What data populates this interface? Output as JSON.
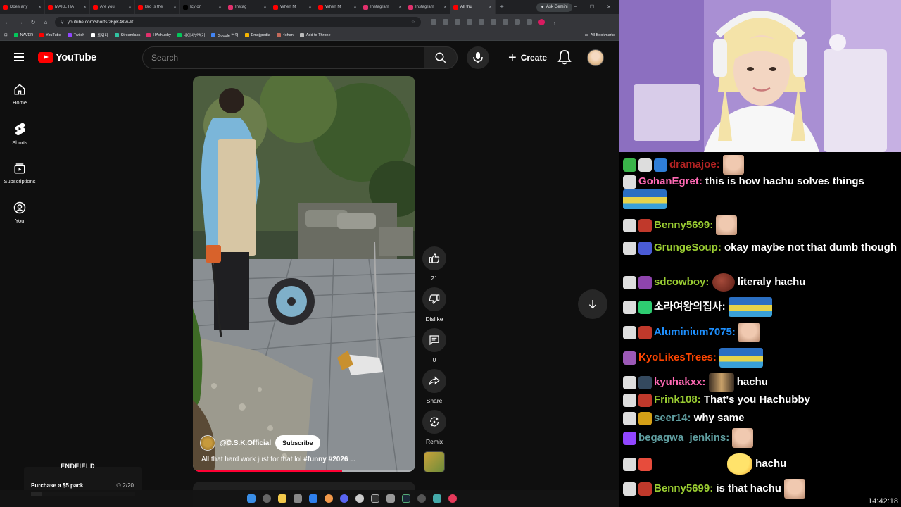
{
  "browser": {
    "tabs": [
      {
        "label": "Does any",
        "color": "#ff0000",
        "active": false
      },
      {
        "label": "MAKE HA",
        "color": "#ff0000",
        "active": false
      },
      {
        "label": "Are you",
        "color": "#ff0000",
        "active": false
      },
      {
        "label": "Bro is the",
        "color": "#ff0000",
        "active": false
      },
      {
        "label": "Icy on",
        "color": "#000000",
        "active": false
      },
      {
        "label": "Instag",
        "color": "#e1306c",
        "active": false
      },
      {
        "label": "When M",
        "color": "#ff0000",
        "active": false
      },
      {
        "label": "When M",
        "color": "#ff0000",
        "active": false
      },
      {
        "label": "Instagram",
        "color": "#e1306c",
        "active": false
      },
      {
        "label": "Instagram",
        "color": "#e1306c",
        "active": false
      },
      {
        "label": "All thu",
        "color": "#ff0000",
        "active": true
      }
    ],
    "new_tab": "+",
    "gemini_label": "Ask Gemini",
    "window_controls": [
      "–",
      "☐",
      "✕"
    ],
    "url": "youtube.com/shorts/26pK4Kw-Ii0",
    "bookmarks": [
      {
        "label": "NAVER",
        "color": "#03c75a"
      },
      {
        "label": "YouTube",
        "color": "#ff0000"
      },
      {
        "label": "Twitch",
        "color": "#9146ff"
      },
      {
        "label": "트위터",
        "color": "#ffffff"
      },
      {
        "label": "Streamlabs",
        "color": "#31c3a2"
      },
      {
        "label": "HAchubby",
        "color": "#e1306c"
      },
      {
        "label": "네이버번역기",
        "color": "#03c75a"
      },
      {
        "label": "Google 번역",
        "color": "#4285f4"
      },
      {
        "label": "Emojipedia",
        "color": "#f7b500"
      },
      {
        "label": "4chan",
        "color": "#c46a5b"
      },
      {
        "label": "Add to Throne",
        "color": "#bbbbbb"
      }
    ],
    "all_bookmarks": "All Bookmarks"
  },
  "youtube": {
    "logo_text": "YouTube",
    "search_placeholder": "Search",
    "create_label": "Create",
    "sidebar": [
      {
        "label": "Home",
        "icon": "home-icon"
      },
      {
        "label": "Shorts",
        "icon": "shorts-icon"
      },
      {
        "label": "Subscriptions",
        "icon": "subscriptions-icon"
      },
      {
        "label": "You",
        "icon": "you-icon"
      }
    ],
    "short": {
      "channel": "@C.S.K.Official",
      "subscribe_label": "Subscribe",
      "caption_text": "All that hard work just for that lol ",
      "caption_tags": "#funny #2026 ...",
      "progress": 0.67
    },
    "actions": {
      "like_count": "21",
      "dislike_label": "Dislike",
      "comment_count": "0",
      "share_label": "Share",
      "remix_label": "Remix"
    }
  },
  "ad": {
    "logo": "ENDFIELD",
    "title": "Purchase a $5 pack",
    "count": "2/20",
    "progress": 0.1
  },
  "chat": {
    "messages": [
      {
        "user": "dramajoe:",
        "color": "#b22222",
        "text": "",
        "badges": [
          "#3ab54a",
          "#dddddd",
          "#2f7ed8"
        ],
        "emote": "face"
      },
      {
        "user": "GohanEgret:",
        "color": "#ff69b4",
        "text": "this is how hachu solves things",
        "badges": [
          "#dddddd"
        ],
        "emote": "car"
      },
      {
        "user": "Benny5699:",
        "color": "#9acd32",
        "text": "",
        "badges": [
          "#dddddd",
          "#c0392b"
        ],
        "emote": "face"
      },
      {
        "user": "GrungeSoup:",
        "color": "#9acd32",
        "text": "okay maybe not that dumb though",
        "badges": [
          "#dddddd",
          "#4a5bd6"
        ],
        "emote": ""
      },
      {
        "user": "sdcowboy:",
        "color": "#9acd32",
        "text": "literaly hachu",
        "badges": [
          "#dddddd",
          "#8e44ad"
        ],
        "emote": "bean"
      },
      {
        "user": "소라여왕의집사:",
        "color": "#ffffff",
        "text": "",
        "badges": [
          "#dddddd",
          "#2ecc71"
        ],
        "emote": "car"
      },
      {
        "user": "Aluminium7075:",
        "color": "#1e90ff",
        "text": "",
        "badges": [
          "#dddddd",
          "#c0392b"
        ],
        "emote": "face"
      },
      {
        "user": "KyoLikesTrees:",
        "color": "#ff4500",
        "text": "",
        "badges": [
          "#9b59b6"
        ],
        "emote": "car"
      },
      {
        "user": "kyuhakxx:",
        "color": "#ff69b4",
        "text": "hachu",
        "badges": [
          "#dddddd",
          "#34495e"
        ],
        "emote": "man"
      },
      {
        "user": "Frink108:",
        "color": "#9acd32",
        "text": "That's you Hachubby",
        "badges": [
          "#dddddd",
          "#c0392b"
        ],
        "emote": ""
      },
      {
        "user": "seer14:",
        "color": "#5f9ea0",
        "text": "why same",
        "badges": [
          "#dddddd",
          "#d4a017"
        ],
        "emote": ""
      },
      {
        "user": "begagwa_jenkins:",
        "color": "#5f9ea0",
        "text": "",
        "badges": [
          "#9146ff"
        ],
        "emote": "face"
      },
      {
        "user": "",
        "color": "#ffffff",
        "text": "hachu",
        "badges": [
          "#dddddd",
          "#e74c3c"
        ],
        "emote": "duck"
      },
      {
        "user": "Benny5699:",
        "color": "#9acd32",
        "text": "is that hachu",
        "badges": [
          "#dddddd",
          "#c0392b"
        ],
        "emote": "face"
      }
    ],
    "clock": "14:42:18"
  }
}
